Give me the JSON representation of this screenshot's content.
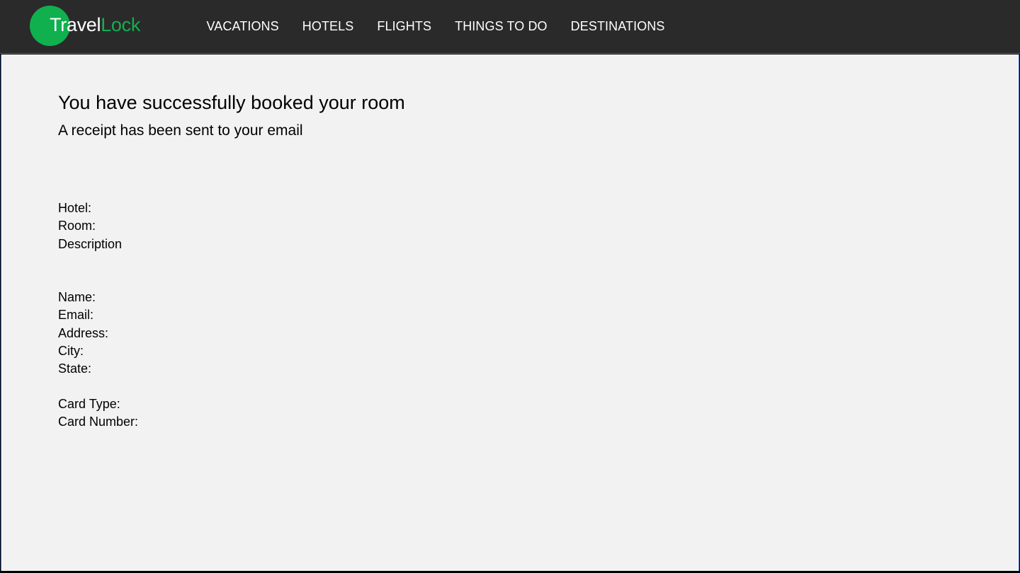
{
  "brand": {
    "name_part1": "Travel",
    "name_part2": "Lock",
    "accent_color": "#10b04f"
  },
  "nav": {
    "items": [
      {
        "label": "VACATIONS"
      },
      {
        "label": "HOTELS"
      },
      {
        "label": "FLIGHTS"
      },
      {
        "label": "THINGS TO DO"
      },
      {
        "label": "DESTINATIONS"
      }
    ]
  },
  "confirmation": {
    "title": "You have successfully booked your room",
    "subtitle": "A receipt has been sent to your email"
  },
  "booking_fields": {
    "hotel": "Hotel:",
    "room": "Room:",
    "description": "Description"
  },
  "customer_fields": {
    "name": "Name:",
    "email": "Email:",
    "address": "Address:",
    "city": "City:",
    "state": "State:"
  },
  "payment_fields": {
    "card_type": "Card Type:",
    "card_number": "Card Number:"
  }
}
